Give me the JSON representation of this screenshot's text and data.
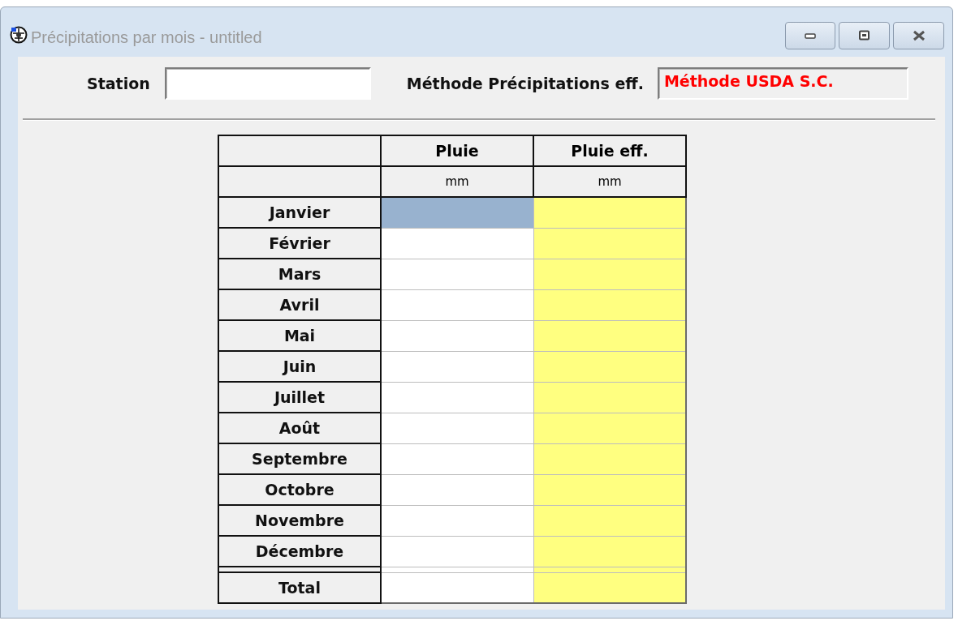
{
  "window": {
    "title": "Précipitations par mois - untitled"
  },
  "station": {
    "label": "Station"
  },
  "method": {
    "label": "Méthode Précipitations eff.",
    "value": "Méthode USDA S.C."
  },
  "table": {
    "columns": [
      {
        "label": "Pluie",
        "unit": "mm",
        "kind": "input"
      },
      {
        "label": "Pluie eff.",
        "unit": "mm",
        "kind": "computed"
      }
    ],
    "rows": [
      {
        "label": "Janvier",
        "cells": [
          {
            "selected": true
          },
          {
            "selected": false
          }
        ]
      },
      {
        "label": "Février",
        "cells": [
          {
            "selected": false
          },
          {
            "selected": false
          }
        ]
      },
      {
        "label": "Mars",
        "cells": [
          {
            "selected": false
          },
          {
            "selected": false
          }
        ]
      },
      {
        "label": "Avril",
        "cells": [
          {
            "selected": false
          },
          {
            "selected": false
          }
        ]
      },
      {
        "label": "Mai",
        "cells": [
          {
            "selected": false
          },
          {
            "selected": false
          }
        ]
      },
      {
        "label": "Juin",
        "cells": [
          {
            "selected": false
          },
          {
            "selected": false
          }
        ]
      },
      {
        "label": "Juillet",
        "cells": [
          {
            "selected": false
          },
          {
            "selected": false
          }
        ]
      },
      {
        "label": "Août",
        "cells": [
          {
            "selected": false
          },
          {
            "selected": false
          }
        ]
      },
      {
        "label": "Septembre",
        "cells": [
          {
            "selected": false
          },
          {
            "selected": false
          }
        ]
      },
      {
        "label": "Octobre",
        "cells": [
          {
            "selected": false
          },
          {
            "selected": false
          }
        ]
      },
      {
        "label": "Novembre",
        "cells": [
          {
            "selected": false
          },
          {
            "selected": false
          }
        ]
      },
      {
        "label": "Décembre",
        "cells": [
          {
            "selected": false
          },
          {
            "selected": false
          }
        ]
      }
    ],
    "total": {
      "label": "Total",
      "cells": [
        {
          "selected": false
        },
        {
          "selected": false
        }
      ]
    }
  }
}
